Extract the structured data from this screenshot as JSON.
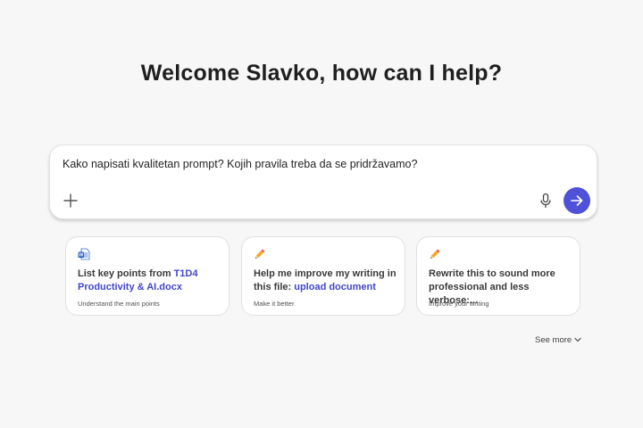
{
  "header": {
    "welcome_title": "Welcome Slavko, how can I help?"
  },
  "composer": {
    "input_value": "Kako napisati kvalitetan prompt? Kojih pravila treba da se pridržavamo?",
    "add_icon": "plus-icon",
    "mic_icon": "microphone-icon",
    "send_icon": "arrow-right-icon",
    "accent_color": "#4f52d8"
  },
  "suggestions": [
    {
      "icon": "word-document-icon",
      "text_prefix": "List key points from ",
      "link_text": "T1D4 Productivity & AI.docx",
      "subtitle": "Understand the main points"
    },
    {
      "icon": "pencil-icon",
      "text_prefix": "Help me improve my writing in this file: ",
      "link_text": "upload document",
      "subtitle": "Make it better"
    },
    {
      "icon": "pencil-icon",
      "text_prefix": "Rewrite this to sound more professional and less verbose:...",
      "link_text": "",
      "subtitle": "Improve your writing"
    }
  ],
  "see_more": {
    "label": "See more",
    "icon": "chevron-down-icon"
  },
  "colors": {
    "background": "#f7f7f7",
    "link": "#4145c9"
  }
}
